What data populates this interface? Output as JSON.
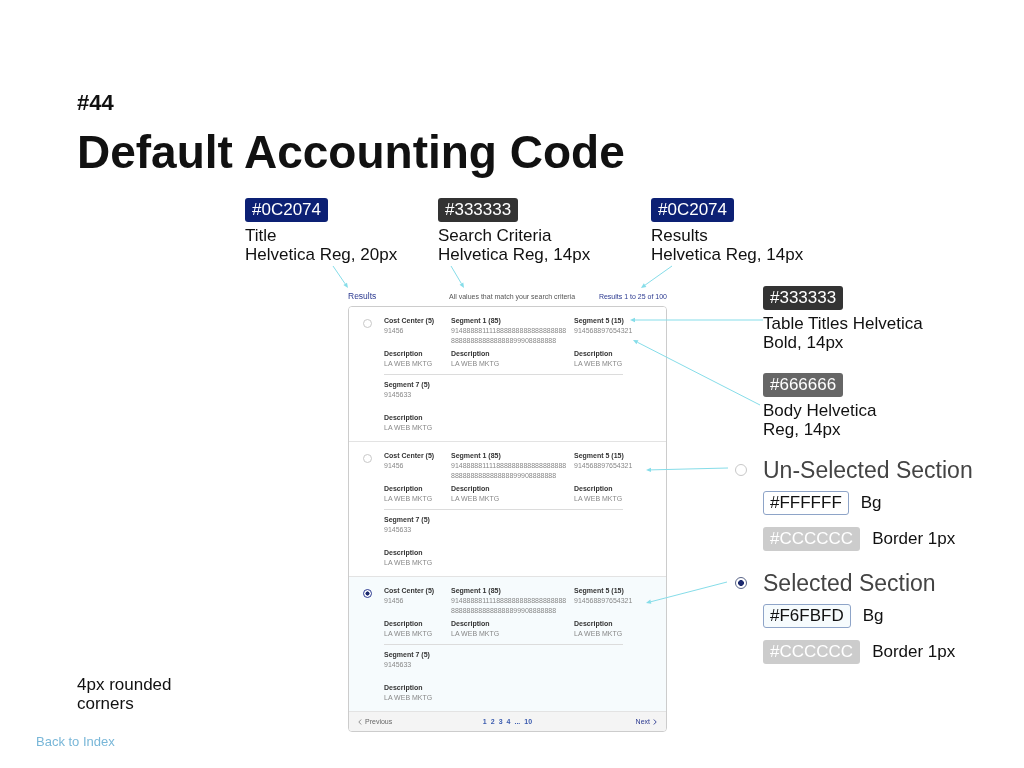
{
  "header": {
    "number": "#44",
    "title": "Default Accounting Code"
  },
  "top_notes": [
    {
      "swatch": {
        "text": "#0C2074",
        "color": "#0c2074",
        "kind": "filled"
      },
      "lines": [
        "Title",
        "Helvetica Reg, 20px"
      ]
    },
    {
      "swatch": {
        "text": "#333333",
        "color": "#333333",
        "kind": "filled"
      },
      "lines": [
        "Search Criteria",
        "Helvetica Reg, 14px"
      ]
    },
    {
      "swatch": {
        "text": "#0C2074",
        "color": "#0c2074",
        "kind": "filled"
      },
      "lines": [
        "Results",
        "Helvetica Reg, 14px"
      ]
    }
  ],
  "results": {
    "title": "Results",
    "criteria": "All values that match your search criteria",
    "count": "Results 1 to 25 of 100",
    "sections": [
      {
        "selected": false,
        "groups": [
          {
            "rows": [
              [
                {
                  "label": "Cost Center (5)",
                  "value": "91456"
                },
                {
                  "label": "Segment 1 (85)",
                  "value": "914888881111888888888888888888888888888888888899908888888"
                },
                {
                  "label": "Segment 5 (15)",
                  "value": "914568897654321"
                }
              ],
              [
                {
                  "label": "Description",
                  "value": "LA WEB MKTG"
                },
                {
                  "label": "Description",
                  "value": "LA WEB MKTG"
                },
                {
                  "label": "Description",
                  "value": "LA WEB MKTG"
                }
              ]
            ]
          },
          {
            "rows": [
              [
                {
                  "label": "Segment 7 (5)",
                  "value": "9145633"
                }
              ],
              [
                {
                  "label": "Description",
                  "value": "LA WEB MKTG"
                }
              ]
            ]
          }
        ]
      },
      {
        "selected": false,
        "groups": [
          {
            "rows": [
              [
                {
                  "label": "Cost Center (5)",
                  "value": "91456"
                },
                {
                  "label": "Segment 1 (85)",
                  "value": "914888881111888888888888888888888888888888888899908888888"
                },
                {
                  "label": "Segment 5 (15)",
                  "value": "914568897654321"
                }
              ],
              [
                {
                  "label": "Description",
                  "value": "LA WEB MKTG"
                },
                {
                  "label": "Description",
                  "value": "LA WEB MKTG"
                },
                {
                  "label": "Description",
                  "value": "LA WEB MKTG"
                }
              ]
            ]
          },
          {
            "rows": [
              [
                {
                  "label": "Segment 7 (5)",
                  "value": "9145633"
                }
              ],
              [
                {
                  "label": "Description",
                  "value": "LA WEB MKTG"
                }
              ]
            ]
          }
        ]
      },
      {
        "selected": true,
        "groups": [
          {
            "rows": [
              [
                {
                  "label": "Cost Center (5)",
                  "value": "91456"
                },
                {
                  "label": "Segment 1 (85)",
                  "value": "914888881111888888888888888888888888888888888899908888888"
                },
                {
                  "label": "Segment 5 (15)",
                  "value": "914568897654321"
                }
              ],
              [
                {
                  "label": "Description",
                  "value": "LA WEB MKTG"
                },
                {
                  "label": "Description",
                  "value": "LA WEB MKTG"
                },
                {
                  "label": "Description",
                  "value": "LA WEB MKTG"
                }
              ]
            ]
          },
          {
            "rows": [
              [
                {
                  "label": "Segment 7 (5)",
                  "value": "9145633"
                }
              ],
              [
                {
                  "label": "Description",
                  "value": "LA WEB MKTG"
                }
              ]
            ]
          }
        ]
      }
    ],
    "pagination": {
      "previous": "Previous",
      "pages": [
        "1",
        "2",
        "3",
        "4",
        "...",
        "10"
      ],
      "next": "Next"
    }
  },
  "legend": [
    {
      "kind": "style",
      "swatch": {
        "text": "#333333",
        "color": "#333333",
        "kind": "filled"
      },
      "lines": [
        "Table Titles Helvetica",
        "Bold, 14px"
      ]
    },
    {
      "kind": "style",
      "swatch": {
        "text": "#666666",
        "color": "#666666",
        "kind": "filled"
      },
      "lines": [
        "Body Helvetica",
        "Reg, 14px"
      ]
    },
    {
      "kind": "state",
      "selected": false,
      "title": "Un-Selected Section",
      "specs": [
        {
          "swatch": {
            "text": "#FFFFFF",
            "color": "#ffffff",
            "kind": "outlined"
          },
          "label": "Bg"
        },
        {
          "swatch": {
            "text": "#CCCCCC",
            "color": "#cccccc",
            "kind": "filled"
          },
          "label": "Border 1px"
        }
      ]
    },
    {
      "kind": "state",
      "selected": true,
      "title": "Selected Section",
      "specs": [
        {
          "swatch": {
            "text": "#F6FBFD",
            "color": "#f6fbfd",
            "kind": "outlined"
          },
          "label": "Bg"
        },
        {
          "swatch": {
            "text": "#CCCCCC",
            "color": "#cccccc",
            "kind": "filled"
          },
          "label": "Border 1px"
        }
      ]
    }
  ],
  "corner_note": "4px rounded corners",
  "back_link": "Back to Index"
}
